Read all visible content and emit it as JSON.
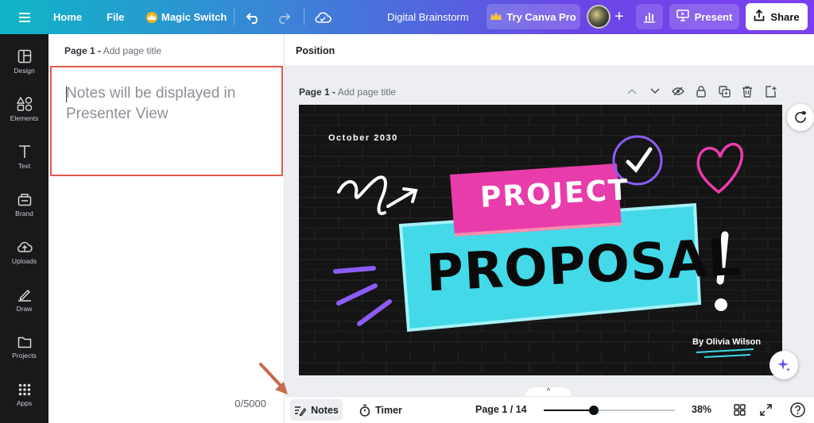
{
  "topbar": {
    "home": "Home",
    "file": "File",
    "magic_switch": "Magic Switch",
    "doc_title": "Digital Brainstorm",
    "try_pro": "Try Canva Pro",
    "present": "Present",
    "share": "Share"
  },
  "sidebar": {
    "items": [
      {
        "label": "Design",
        "icon": "layout-icon"
      },
      {
        "label": "Elements",
        "icon": "shapes-icon"
      },
      {
        "label": "Text",
        "icon": "text-icon"
      },
      {
        "label": "Brand",
        "icon": "brand-icon"
      },
      {
        "label": "Uploads",
        "icon": "upload-icon"
      },
      {
        "label": "Draw",
        "icon": "draw-icon"
      },
      {
        "label": "Projects",
        "icon": "folder-icon"
      },
      {
        "label": "Apps",
        "icon": "apps-icon"
      }
    ]
  },
  "notes": {
    "page_label": "Page 1 -",
    "page_title_placeholder": "Add page title",
    "placeholder": "Notes will be displayed in Presenter View",
    "char_count": "0/5000"
  },
  "main": {
    "position": "Position",
    "page_label": "Page 1 -",
    "page_title_placeholder": "Add page title"
  },
  "slide": {
    "date": "October 2030",
    "word1": "PROJECT",
    "word2": "PROPOSAL",
    "author": "By Olivia Wilson"
  },
  "bottombar": {
    "notes": "Notes",
    "timer": "Timer",
    "page_count": "Page 1 / 14",
    "zoom_label": "38%",
    "zoom_level": 0.38
  },
  "colors": {
    "accent_red": "#e2584b",
    "slide_pink": "#e83cab",
    "slide_cyan": "#43d9e8",
    "slide_purple": "#8b5cf6"
  }
}
